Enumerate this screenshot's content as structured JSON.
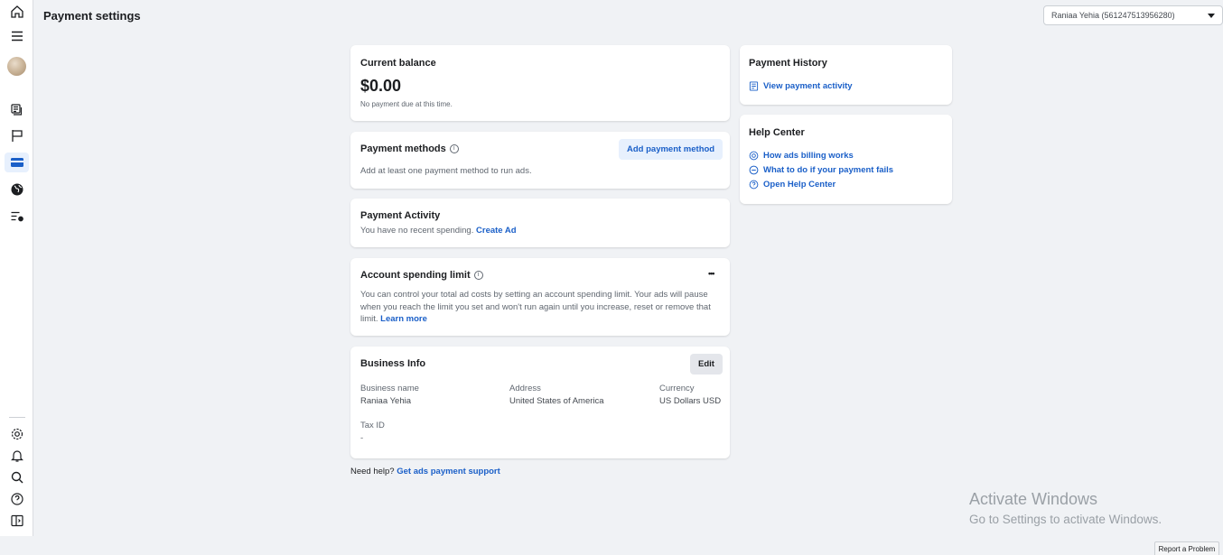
{
  "header": {
    "title": "Payment settings",
    "account_selector": "Raniaa Yehia (561247513956280)"
  },
  "rail": {
    "icons": [
      "home-icon",
      "menu-icon",
      "avatar",
      "campaigns-icon",
      "flag-icon",
      "billing-card-icon",
      "globe-icon",
      "settings-list-icon",
      "gear-icon",
      "bell-icon",
      "search-icon",
      "help-icon",
      "collapse-sidebar-icon"
    ],
    "accent": "#1a5fc8"
  },
  "balance": {
    "title": "Current balance",
    "amount": "$0.00",
    "note": "No payment due at this time."
  },
  "payment_methods": {
    "title": "Payment methods",
    "add_button": "Add payment method",
    "description": "Add at least one payment method to run ads."
  },
  "payment_activity": {
    "title": "Payment Activity",
    "text": "You have no recent spending.",
    "link": "Create Ad"
  },
  "spending_limit": {
    "title": "Account spending limit",
    "more": "•••",
    "description": "You can control your total ad costs by setting an account spending limit. Your ads will pause when you reach the limit you set and won't run again until you increase, reset or remove that limit.",
    "link": "Learn more"
  },
  "business_info": {
    "title": "Business Info",
    "edit_button": "Edit",
    "name_label": "Business name",
    "name_value": "Raniaa Yehia",
    "address_label": "Address",
    "address_value": "United States of America",
    "currency_label": "Currency",
    "currency_value": "US Dollars USD",
    "tax_label": "Tax ID",
    "tax_value": "-"
  },
  "help_footer": {
    "text": "Need help?",
    "link": "Get ads payment support"
  },
  "payment_history": {
    "title": "Payment History",
    "link": "View payment activity"
  },
  "help_center": {
    "title": "Help Center",
    "links": [
      "How ads billing works",
      "What to do if your payment fails",
      "Open Help Center"
    ]
  },
  "watermark": {
    "line1": "Activate Windows",
    "line2": "Go to Settings to activate Windows."
  },
  "report_button": "Report a Problem"
}
